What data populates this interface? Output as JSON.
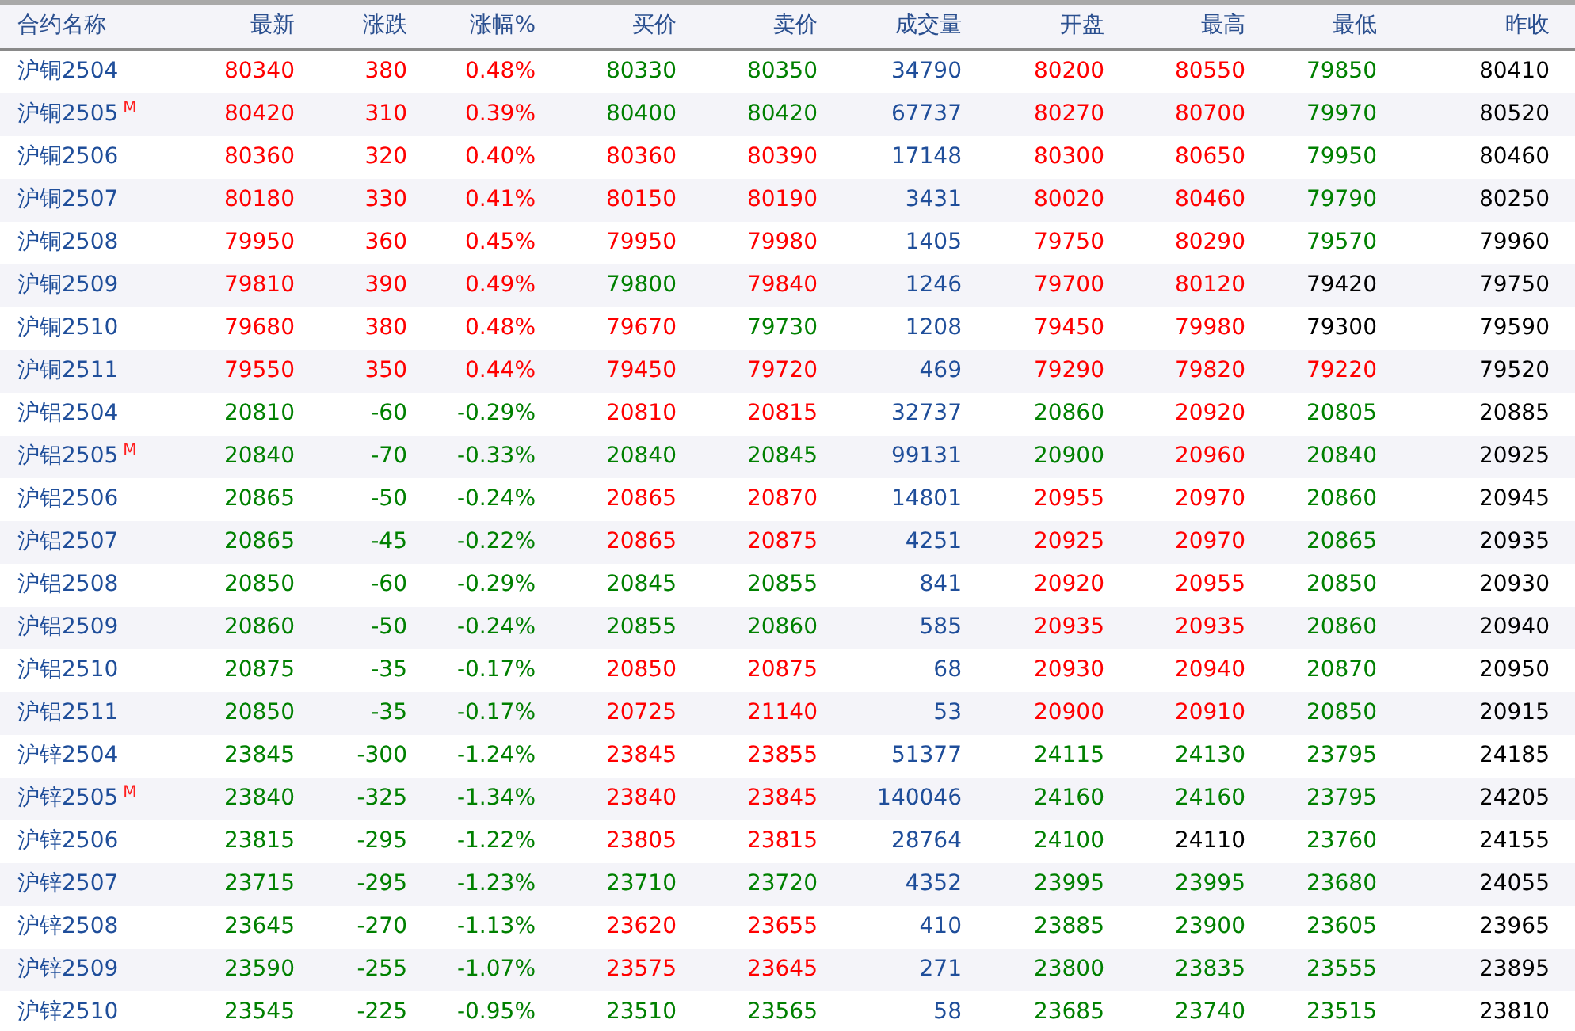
{
  "columns": [
    "合约名称",
    "最新",
    "涨跌",
    "涨幅%",
    "买价",
    "卖价",
    "成交量",
    "开盘",
    "最高",
    "最低",
    "昨收"
  ],
  "rows": [
    {
      "name": "沪铜2504",
      "cells": [
        {
          "text": "80340",
          "color": "#ff0000"
        },
        {
          "text": "380",
          "color": "#ff0000"
        },
        {
          "text": "0.48%",
          "color": "#ff0000"
        },
        {
          "text": "80330",
          "color": "#008000"
        },
        {
          "text": "80350",
          "color": "#008000"
        },
        {
          "text": "34790",
          "color": "#1f4e9a"
        },
        {
          "text": "80200",
          "color": "#ff0000"
        },
        {
          "text": "80550",
          "color": "#ff0000"
        },
        {
          "text": "79850",
          "color": "#008000"
        },
        {
          "text": "80410",
          "color": "#000000"
        }
      ]
    },
    {
      "name": "沪铜2505",
      "badge": "M",
      "cells": [
        {
          "text": "80420",
          "color": "#ff0000"
        },
        {
          "text": "310",
          "color": "#ff0000"
        },
        {
          "text": "0.39%",
          "color": "#ff0000"
        },
        {
          "text": "80400",
          "color": "#008000"
        },
        {
          "text": "80420",
          "color": "#008000"
        },
        {
          "text": "67737",
          "color": "#1f4e9a"
        },
        {
          "text": "80270",
          "color": "#ff0000"
        },
        {
          "text": "80700",
          "color": "#ff0000"
        },
        {
          "text": "79970",
          "color": "#008000"
        },
        {
          "text": "80520",
          "color": "#000000"
        }
      ]
    },
    {
      "name": "沪铜2506",
      "cells": [
        {
          "text": "80360",
          "color": "#ff0000"
        },
        {
          "text": "320",
          "color": "#ff0000"
        },
        {
          "text": "0.40%",
          "color": "#ff0000"
        },
        {
          "text": "80360",
          "color": "#ff0000"
        },
        {
          "text": "80390",
          "color": "#ff0000"
        },
        {
          "text": "17148",
          "color": "#1f4e9a"
        },
        {
          "text": "80300",
          "color": "#ff0000"
        },
        {
          "text": "80650",
          "color": "#ff0000"
        },
        {
          "text": "79950",
          "color": "#008000"
        },
        {
          "text": "80460",
          "color": "#000000"
        }
      ]
    },
    {
      "name": "沪铜2507",
      "cells": [
        {
          "text": "80180",
          "color": "#ff0000"
        },
        {
          "text": "330",
          "color": "#ff0000"
        },
        {
          "text": "0.41%",
          "color": "#ff0000"
        },
        {
          "text": "80150",
          "color": "#ff0000"
        },
        {
          "text": "80190",
          "color": "#ff0000"
        },
        {
          "text": "3431",
          "color": "#1f4e9a"
        },
        {
          "text": "80020",
          "color": "#ff0000"
        },
        {
          "text": "80460",
          "color": "#ff0000"
        },
        {
          "text": "79790",
          "color": "#008000"
        },
        {
          "text": "80250",
          "color": "#000000"
        }
      ]
    },
    {
      "name": "沪铜2508",
      "cells": [
        {
          "text": "79950",
          "color": "#ff0000"
        },
        {
          "text": "360",
          "color": "#ff0000"
        },
        {
          "text": "0.45%",
          "color": "#ff0000"
        },
        {
          "text": "79950",
          "color": "#ff0000"
        },
        {
          "text": "79980",
          "color": "#ff0000"
        },
        {
          "text": "1405",
          "color": "#1f4e9a"
        },
        {
          "text": "79750",
          "color": "#ff0000"
        },
        {
          "text": "80290",
          "color": "#ff0000"
        },
        {
          "text": "79570",
          "color": "#008000"
        },
        {
          "text": "79960",
          "color": "#000000"
        }
      ]
    },
    {
      "name": "沪铜2509",
      "cells": [
        {
          "text": "79810",
          "color": "#ff0000"
        },
        {
          "text": "390",
          "color": "#ff0000"
        },
        {
          "text": "0.49%",
          "color": "#ff0000"
        },
        {
          "text": "79800",
          "color": "#008000"
        },
        {
          "text": "79840",
          "color": "#ff0000"
        },
        {
          "text": "1246",
          "color": "#1f4e9a"
        },
        {
          "text": "79700",
          "color": "#ff0000"
        },
        {
          "text": "80120",
          "color": "#ff0000"
        },
        {
          "text": "79420",
          "color": "#000000"
        },
        {
          "text": "79750",
          "color": "#000000"
        }
      ]
    },
    {
      "name": "沪铜2510",
      "cells": [
        {
          "text": "79680",
          "color": "#ff0000"
        },
        {
          "text": "380",
          "color": "#ff0000"
        },
        {
          "text": "0.48%",
          "color": "#ff0000"
        },
        {
          "text": "79670",
          "color": "#ff0000"
        },
        {
          "text": "79730",
          "color": "#008000"
        },
        {
          "text": "1208",
          "color": "#1f4e9a"
        },
        {
          "text": "79450",
          "color": "#ff0000"
        },
        {
          "text": "79980",
          "color": "#ff0000"
        },
        {
          "text": "79300",
          "color": "#000000"
        },
        {
          "text": "79590",
          "color": "#000000"
        }
      ]
    },
    {
      "name": "沪铜2511",
      "cells": [
        {
          "text": "79550",
          "color": "#ff0000"
        },
        {
          "text": "350",
          "color": "#ff0000"
        },
        {
          "text": "0.44%",
          "color": "#ff0000"
        },
        {
          "text": "79450",
          "color": "#ff0000"
        },
        {
          "text": "79720",
          "color": "#ff0000"
        },
        {
          "text": "469",
          "color": "#1f4e9a"
        },
        {
          "text": "79290",
          "color": "#ff0000"
        },
        {
          "text": "79820",
          "color": "#ff0000"
        },
        {
          "text": "79220",
          "color": "#ff0000"
        },
        {
          "text": "79520",
          "color": "#000000"
        }
      ]
    },
    {
      "name": "沪铝2504",
      "cells": [
        {
          "text": "20810",
          "color": "#008000"
        },
        {
          "text": "-60",
          "color": "#008000"
        },
        {
          "text": "-0.29%",
          "color": "#008000"
        },
        {
          "text": "20810",
          "color": "#ff0000"
        },
        {
          "text": "20815",
          "color": "#ff0000"
        },
        {
          "text": "32737",
          "color": "#1f4e9a"
        },
        {
          "text": "20860",
          "color": "#008000"
        },
        {
          "text": "20920",
          "color": "#ff0000"
        },
        {
          "text": "20805",
          "color": "#008000"
        },
        {
          "text": "20885",
          "color": "#000000"
        }
      ]
    },
    {
      "name": "沪铝2505",
      "badge": "M",
      "cells": [
        {
          "text": "20840",
          "color": "#008000"
        },
        {
          "text": "-70",
          "color": "#008000"
        },
        {
          "text": "-0.33%",
          "color": "#008000"
        },
        {
          "text": "20840",
          "color": "#008000"
        },
        {
          "text": "20845",
          "color": "#008000"
        },
        {
          "text": "99131",
          "color": "#1f4e9a"
        },
        {
          "text": "20900",
          "color": "#008000"
        },
        {
          "text": "20960",
          "color": "#ff0000"
        },
        {
          "text": "20840",
          "color": "#008000"
        },
        {
          "text": "20925",
          "color": "#000000"
        }
      ]
    },
    {
      "name": "沪铝2506",
      "cells": [
        {
          "text": "20865",
          "color": "#008000"
        },
        {
          "text": "-50",
          "color": "#008000"
        },
        {
          "text": "-0.24%",
          "color": "#008000"
        },
        {
          "text": "20865",
          "color": "#ff0000"
        },
        {
          "text": "20870",
          "color": "#ff0000"
        },
        {
          "text": "14801",
          "color": "#1f4e9a"
        },
        {
          "text": "20955",
          "color": "#ff0000"
        },
        {
          "text": "20970",
          "color": "#ff0000"
        },
        {
          "text": "20860",
          "color": "#008000"
        },
        {
          "text": "20945",
          "color": "#000000"
        }
      ]
    },
    {
      "name": "沪铝2507",
      "cells": [
        {
          "text": "20865",
          "color": "#008000"
        },
        {
          "text": "-45",
          "color": "#008000"
        },
        {
          "text": "-0.22%",
          "color": "#008000"
        },
        {
          "text": "20865",
          "color": "#ff0000"
        },
        {
          "text": "20875",
          "color": "#ff0000"
        },
        {
          "text": "4251",
          "color": "#1f4e9a"
        },
        {
          "text": "20925",
          "color": "#ff0000"
        },
        {
          "text": "20970",
          "color": "#ff0000"
        },
        {
          "text": "20865",
          "color": "#008000"
        },
        {
          "text": "20935",
          "color": "#000000"
        }
      ]
    },
    {
      "name": "沪铝2508",
      "cells": [
        {
          "text": "20850",
          "color": "#008000"
        },
        {
          "text": "-60",
          "color": "#008000"
        },
        {
          "text": "-0.29%",
          "color": "#008000"
        },
        {
          "text": "20845",
          "color": "#008000"
        },
        {
          "text": "20855",
          "color": "#008000"
        },
        {
          "text": "841",
          "color": "#1f4e9a"
        },
        {
          "text": "20920",
          "color": "#ff0000"
        },
        {
          "text": "20955",
          "color": "#ff0000"
        },
        {
          "text": "20850",
          "color": "#008000"
        },
        {
          "text": "20930",
          "color": "#000000"
        }
      ]
    },
    {
      "name": "沪铝2509",
      "cells": [
        {
          "text": "20860",
          "color": "#008000"
        },
        {
          "text": "-50",
          "color": "#008000"
        },
        {
          "text": "-0.24%",
          "color": "#008000"
        },
        {
          "text": "20855",
          "color": "#008000"
        },
        {
          "text": "20860",
          "color": "#008000"
        },
        {
          "text": "585",
          "color": "#1f4e9a"
        },
        {
          "text": "20935",
          "color": "#ff0000"
        },
        {
          "text": "20935",
          "color": "#ff0000"
        },
        {
          "text": "20860",
          "color": "#008000"
        },
        {
          "text": "20940",
          "color": "#000000"
        }
      ]
    },
    {
      "name": "沪铝2510",
      "cells": [
        {
          "text": "20875",
          "color": "#008000"
        },
        {
          "text": "-35",
          "color": "#008000"
        },
        {
          "text": "-0.17%",
          "color": "#008000"
        },
        {
          "text": "20850",
          "color": "#ff0000"
        },
        {
          "text": "20875",
          "color": "#ff0000"
        },
        {
          "text": "68",
          "color": "#1f4e9a"
        },
        {
          "text": "20930",
          "color": "#ff0000"
        },
        {
          "text": "20940",
          "color": "#ff0000"
        },
        {
          "text": "20870",
          "color": "#008000"
        },
        {
          "text": "20950",
          "color": "#000000"
        }
      ]
    },
    {
      "name": "沪铝2511",
      "cells": [
        {
          "text": "20850",
          "color": "#008000"
        },
        {
          "text": "-35",
          "color": "#008000"
        },
        {
          "text": "-0.17%",
          "color": "#008000"
        },
        {
          "text": "20725",
          "color": "#ff0000"
        },
        {
          "text": "21140",
          "color": "#ff0000"
        },
        {
          "text": "53",
          "color": "#1f4e9a"
        },
        {
          "text": "20900",
          "color": "#ff0000"
        },
        {
          "text": "20910",
          "color": "#ff0000"
        },
        {
          "text": "20850",
          "color": "#008000"
        },
        {
          "text": "20915",
          "color": "#000000"
        }
      ]
    },
    {
      "name": "沪锌2504",
      "cells": [
        {
          "text": "23845",
          "color": "#008000"
        },
        {
          "text": "-300",
          "color": "#008000"
        },
        {
          "text": "-1.24%",
          "color": "#008000"
        },
        {
          "text": "23845",
          "color": "#ff0000"
        },
        {
          "text": "23855",
          "color": "#ff0000"
        },
        {
          "text": "51377",
          "color": "#1f4e9a"
        },
        {
          "text": "24115",
          "color": "#008000"
        },
        {
          "text": "24130",
          "color": "#008000"
        },
        {
          "text": "23795",
          "color": "#008000"
        },
        {
          "text": "24185",
          "color": "#000000"
        }
      ]
    },
    {
      "name": "沪锌2505",
      "badge": "M",
      "cells": [
        {
          "text": "23840",
          "color": "#008000"
        },
        {
          "text": "-325",
          "color": "#008000"
        },
        {
          "text": "-1.34%",
          "color": "#008000"
        },
        {
          "text": "23840",
          "color": "#ff0000"
        },
        {
          "text": "23845",
          "color": "#ff0000"
        },
        {
          "text": "140046",
          "color": "#1f4e9a"
        },
        {
          "text": "24160",
          "color": "#008000"
        },
        {
          "text": "24160",
          "color": "#008000"
        },
        {
          "text": "23795",
          "color": "#008000"
        },
        {
          "text": "24205",
          "color": "#000000"
        }
      ]
    },
    {
      "name": "沪锌2506",
      "cells": [
        {
          "text": "23815",
          "color": "#008000"
        },
        {
          "text": "-295",
          "color": "#008000"
        },
        {
          "text": "-1.22%",
          "color": "#008000"
        },
        {
          "text": "23805",
          "color": "#ff0000"
        },
        {
          "text": "23815",
          "color": "#ff0000"
        },
        {
          "text": "28764",
          "color": "#1f4e9a"
        },
        {
          "text": "24100",
          "color": "#008000"
        },
        {
          "text": "24110",
          "color": "#000000"
        },
        {
          "text": "23760",
          "color": "#008000"
        },
        {
          "text": "24155",
          "color": "#000000"
        }
      ]
    },
    {
      "name": "沪锌2507",
      "cells": [
        {
          "text": "23715",
          "color": "#008000"
        },
        {
          "text": "-295",
          "color": "#008000"
        },
        {
          "text": "-1.23%",
          "color": "#008000"
        },
        {
          "text": "23710",
          "color": "#008000"
        },
        {
          "text": "23720",
          "color": "#008000"
        },
        {
          "text": "4352",
          "color": "#1f4e9a"
        },
        {
          "text": "23995",
          "color": "#008000"
        },
        {
          "text": "23995",
          "color": "#008000"
        },
        {
          "text": "23680",
          "color": "#008000"
        },
        {
          "text": "24055",
          "color": "#000000"
        }
      ]
    },
    {
      "name": "沪锌2508",
      "cells": [
        {
          "text": "23645",
          "color": "#008000"
        },
        {
          "text": "-270",
          "color": "#008000"
        },
        {
          "text": "-1.13%",
          "color": "#008000"
        },
        {
          "text": "23620",
          "color": "#ff0000"
        },
        {
          "text": "23655",
          "color": "#ff0000"
        },
        {
          "text": "410",
          "color": "#1f4e9a"
        },
        {
          "text": "23885",
          "color": "#008000"
        },
        {
          "text": "23900",
          "color": "#008000"
        },
        {
          "text": "23605",
          "color": "#008000"
        },
        {
          "text": "23965",
          "color": "#000000"
        }
      ]
    },
    {
      "name": "沪锌2509",
      "cells": [
        {
          "text": "23590",
          "color": "#008000"
        },
        {
          "text": "-255",
          "color": "#008000"
        },
        {
          "text": "-1.07%",
          "color": "#008000"
        },
        {
          "text": "23575",
          "color": "#ff0000"
        },
        {
          "text": "23645",
          "color": "#ff0000"
        },
        {
          "text": "271",
          "color": "#1f4e9a"
        },
        {
          "text": "23800",
          "color": "#008000"
        },
        {
          "text": "23835",
          "color": "#008000"
        },
        {
          "text": "23555",
          "color": "#008000"
        },
        {
          "text": "23895",
          "color": "#000000"
        }
      ]
    },
    {
      "name": "沪锌2510",
      "cells": [
        {
          "text": "23545",
          "color": "#008000"
        },
        {
          "text": "-225",
          "color": "#008000"
        },
        {
          "text": "-0.95%",
          "color": "#008000"
        },
        {
          "text": "23510",
          "color": "#008000"
        },
        {
          "text": "23565",
          "color": "#008000"
        },
        {
          "text": "58",
          "color": "#1f4e9a"
        },
        {
          "text": "23685",
          "color": "#008000"
        },
        {
          "text": "23740",
          "color": "#008000"
        },
        {
          "text": "23515",
          "color": "#008000"
        },
        {
          "text": "23810",
          "color": "#000000"
        }
      ]
    }
  ]
}
